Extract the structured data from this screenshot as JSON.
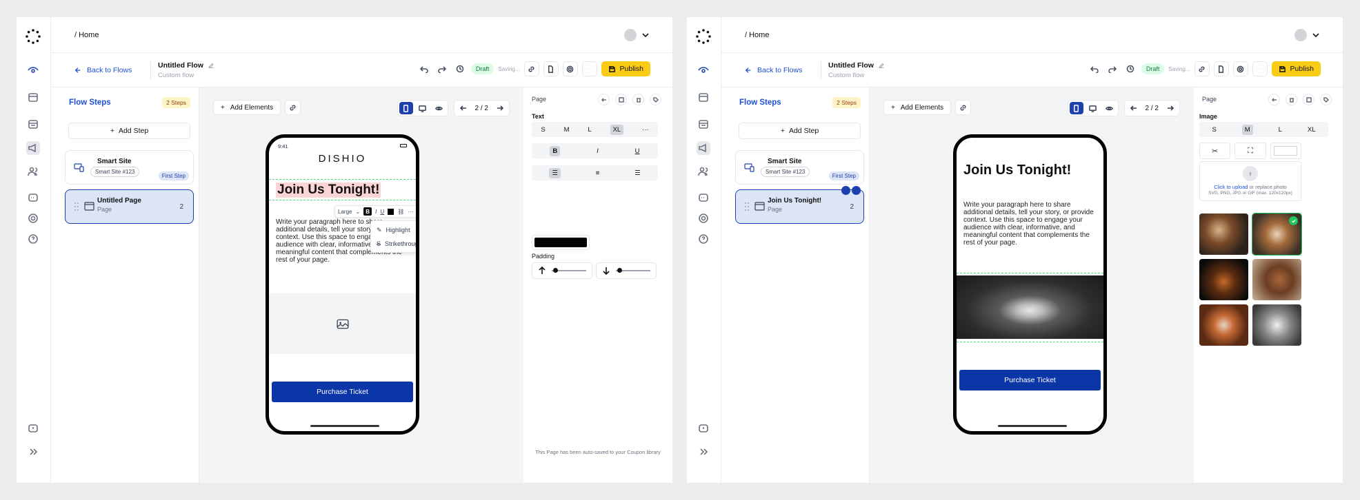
{
  "common": {
    "breadcrumb": "/ Home",
    "back_label": "Back to Flows",
    "flow_title": "Untitled Flow",
    "flow_subtitle": "Custom flow",
    "draft_badge": "Draft",
    "saving_label": "Saving...",
    "publish_label": "Publish",
    "flow_steps_title": "Flow Steps",
    "steps_badge": "2 Steps",
    "add_step_label": "Add Step",
    "site_card": {
      "name": "Smart Site",
      "pill": "Smart Site #123",
      "badge": "First Step"
    },
    "add_elements_label": "Add Elements",
    "pager": "2 / 2",
    "panel_title": "Page",
    "purchase_label": "Purchase Ticket"
  },
  "left_screen": {
    "page_card": {
      "name": "Untitled Page",
      "sub": "Page",
      "num": "2"
    },
    "phone": {
      "time": "9:41",
      "logo": "DISHIO",
      "title": "Join Us Tonight!",
      "paragraph": "Write your paragraph here to share additional details, tell your story, or provide context. Use this space to engage your audience with clear, informative, and meaningful content that complements the rest of your page.",
      "toolbar_size": "Large",
      "menu": [
        "Highlight",
        "Strikethrough"
      ]
    },
    "panel": {
      "text_label": "Text",
      "sizes": [
        "S",
        "M",
        "L",
        "XL"
      ],
      "selected_size": "XL",
      "styles": [
        "B",
        "I",
        "U"
      ],
      "padding_label": "Padding",
      "color": "#000000",
      "footer_note": "This Page has been auto-saved to your Coupon library"
    }
  },
  "right_screen": {
    "page_card": {
      "name": "Join Us Tonight!",
      "sub": "Page",
      "num": "2"
    },
    "phone": {
      "title": "Join Us Tonight!",
      "paragraph": "Write your paragraph here to share additional details, tell your story, or provide context. Use this space to engage your audience with clear, informative, and meaningful content that complements the rest of your page."
    },
    "panel": {
      "image_label": "Image",
      "sizes": [
        "S",
        "M",
        "L",
        "XL"
      ],
      "selected_size": "M",
      "upload_link": "Click to upload",
      "upload_rest": "or replace photo",
      "upload_hint": "SVG, PNG, JPG or GIF (max. 120x120px)",
      "thumbnails": 6,
      "selected_thumbnail": 2
    }
  },
  "colors": {
    "accent": "#1e40af",
    "publish": "#facc15",
    "draft_bg": "#dcfce7",
    "button": "#0b36a8"
  }
}
